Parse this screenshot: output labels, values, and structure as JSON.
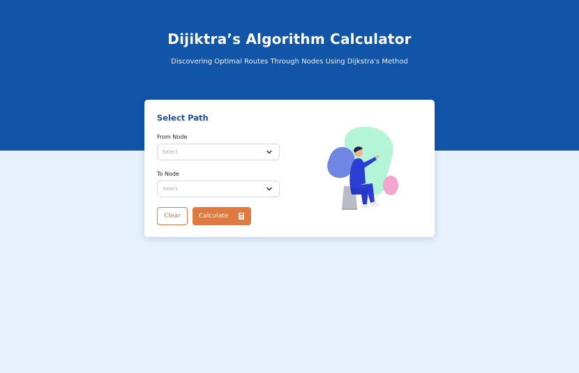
{
  "header": {
    "title": "Dijiktra’s Algorithm Calculator",
    "subtitle": "Discovering Optimal Routes Through Nodes Using Dijkstra's Method"
  },
  "card": {
    "title": "Select Path",
    "from": {
      "label": "From Node",
      "placeholder": "Select"
    },
    "to": {
      "label": "To Node",
      "placeholder": "Select"
    },
    "clear_label": "Clear",
    "calculate_label": "Calculate"
  },
  "icons": {
    "dropdown": "chevron-down-icon",
    "calculate": "calculator-icon"
  },
  "colors": {
    "header_bg": "#1155a8",
    "page_bg": "#e6f1fd",
    "accent_orange": "#df7a42",
    "title_blue": "#1b4fa0"
  }
}
